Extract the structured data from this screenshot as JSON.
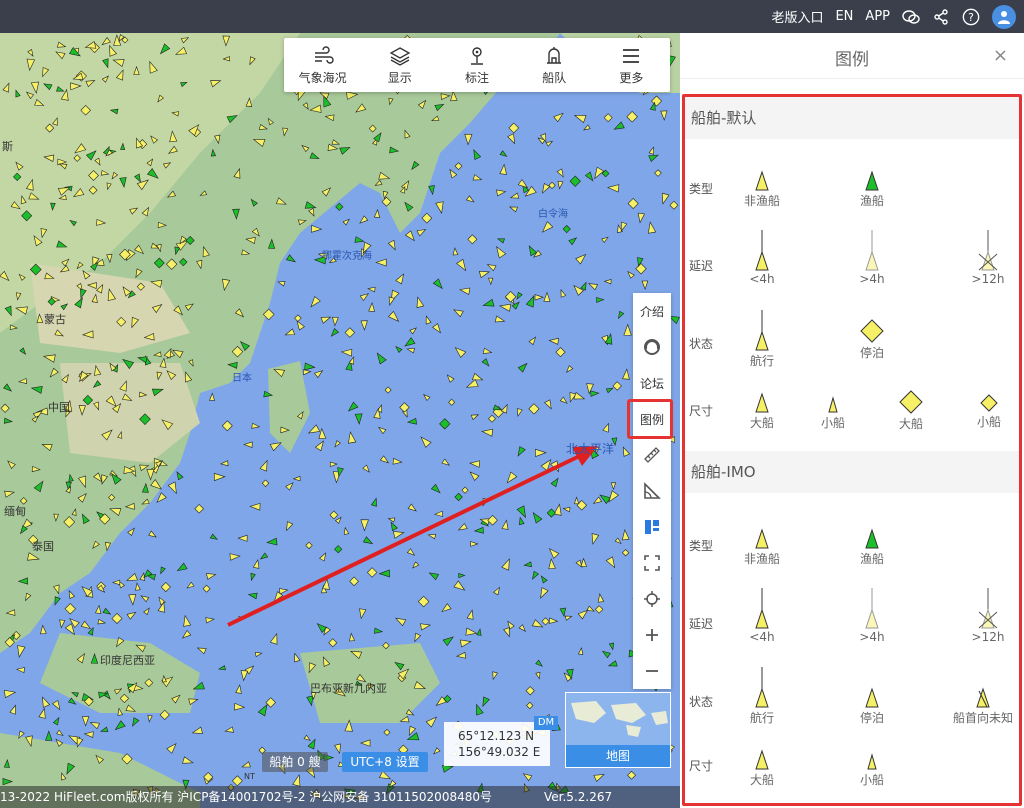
{
  "topbar": {
    "links": [
      "老版入口",
      "EN",
      "APP"
    ],
    "icons": [
      "wechat-icon",
      "share-icon",
      "help-icon",
      "user-icon"
    ]
  },
  "toolbar": {
    "items": [
      {
        "label": "气象海况",
        "icon": "weather-icon"
      },
      {
        "label": "显示",
        "icon": "layers-icon"
      },
      {
        "label": "标注",
        "icon": "marker-icon"
      },
      {
        "label": "船队",
        "icon": "fleet-icon"
      },
      {
        "label": "更多",
        "icon": "menu-icon"
      }
    ]
  },
  "side_tools": {
    "intro": "介绍",
    "forum": "论坛",
    "legend": "图例",
    "icons": [
      "headset-icon",
      "ruler-icon",
      "angle-icon",
      "layout-icon",
      "fullscreen-icon",
      "locate-icon",
      "zoom-in-icon",
      "zoom-out-icon"
    ]
  },
  "map": {
    "labels": [
      "斯",
      "蒙古",
      "中国",
      "缅甸",
      "泰国",
      "日本",
      "白令海",
      "鄂霍次克海",
      "北太平洋",
      "巴布亚新几内亚",
      "印度尼西亚",
      "NT"
    ],
    "coords": {
      "lat": "65°12.123 N",
      "lon": "156°49.032 E"
    },
    "dm": "DM",
    "mini_map_label": "地图",
    "ship_count": "船舶 0 艘",
    "utc": "UTC+8 设置",
    "footer": "13-2022 HiFleet.com版权所有 沪ICP备14001702号-2 沪公网安备 31011502008480号",
    "version": "Ver.5.2.267"
  },
  "legend": {
    "title": "图例",
    "close": "×",
    "sections": [
      {
        "title": "船舶-默认",
        "rows": [
          {
            "label": "类型",
            "items": [
              "非渔船",
              "渔船"
            ]
          },
          {
            "label": "延迟",
            "items": [
              "<4h",
              ">4h",
              ">12h"
            ]
          },
          {
            "label": "状态",
            "items": [
              "航行",
              "停泊"
            ]
          },
          {
            "label": "尺寸",
            "items": [
              "大船",
              "小船",
              "大船",
              "小船"
            ]
          }
        ]
      },
      {
        "title": "船舶-IMO",
        "rows": [
          {
            "label": "类型",
            "items": [
              "非渔船",
              "渔船"
            ]
          },
          {
            "label": "延迟",
            "items": [
              "<4h",
              ">4h",
              ">12h"
            ]
          },
          {
            "label": "状态",
            "items": [
              "航行",
              "停泊",
              "船首向未知"
            ]
          },
          {
            "label": "尺寸",
            "items": [
              "大船",
              "小船"
            ]
          }
        ]
      }
    ]
  },
  "colors": {
    "ship_yellow": "#f5f065",
    "fishing_green": "#1bbf2a",
    "ocean": "#7fa6e8",
    "highlight_red": "#e53232",
    "accent_blue": "#3a8ee6"
  }
}
